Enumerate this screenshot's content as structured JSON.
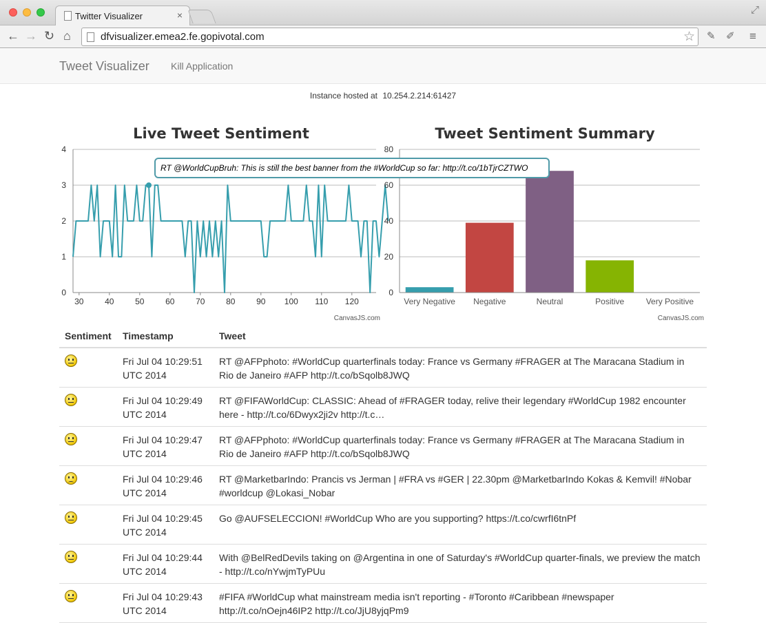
{
  "browser": {
    "tab_title": "Twitter Visualizer",
    "tab_close": "×",
    "url": "dfvisualizer.emea2.fe.gopivotal.com"
  },
  "navbar": {
    "brand": "Tweet Visualizer",
    "link": "Kill Application"
  },
  "instance": {
    "label": "Instance hosted at",
    "address": "10.254.2.214:61427"
  },
  "chart_data": [
    {
      "type": "line",
      "title": "Live Tweet Sentiment",
      "xlim": [
        28,
        128
      ],
      "ylim": [
        0,
        4
      ],
      "xticks": [
        30,
        40,
        50,
        60,
        70,
        80,
        90,
        100,
        110,
        120
      ],
      "yticks": [
        0,
        1,
        2,
        3,
        4
      ],
      "credit": "CanvasJS.com",
      "color": "#369ead",
      "highlight_x": 53,
      "tooltip": "RT @WorldCupBruh: This is still the best banner from the #WorldCup so far: http://t.co/1bTjrCZTWO",
      "x_start": 28,
      "values": [
        1,
        2,
        2,
        2,
        2,
        2,
        3,
        2,
        3,
        1,
        2,
        2,
        2,
        1,
        3,
        1,
        1,
        3,
        2,
        2,
        2,
        3,
        2,
        2,
        3,
        3,
        1,
        3,
        3,
        2,
        2,
        2,
        2,
        2,
        2,
        2,
        2,
        1,
        2,
        2,
        0,
        2,
        1,
        2,
        1,
        2,
        1,
        2,
        1,
        2,
        0,
        3,
        2,
        2,
        2,
        2,
        2,
        2,
        2,
        2,
        2,
        2,
        2,
        1,
        1,
        2,
        2,
        2,
        2,
        2,
        2,
        3,
        2,
        2,
        2,
        2,
        2,
        3,
        2,
        2,
        1,
        3,
        1,
        3,
        2,
        2,
        2,
        2,
        2,
        2,
        2,
        3,
        2,
        2,
        2,
        1,
        2,
        2,
        0,
        2,
        2,
        1,
        2,
        3,
        2
      ]
    },
    {
      "type": "bar",
      "title": "Tweet Sentiment Summary",
      "categories": [
        "Very Negative",
        "Negative",
        "Neutral",
        "Positive",
        "Very Positive"
      ],
      "values": [
        3,
        39,
        68,
        18,
        0
      ],
      "colors": [
        "#369ead",
        "#c24642",
        "#7f6084",
        "#86b402",
        "#a2d1cf"
      ],
      "ylim": [
        0,
        80
      ],
      "yticks": [
        0,
        20,
        40,
        60,
        80
      ],
      "credit": "CanvasJS.com"
    }
  ],
  "table": {
    "headers": [
      "Sentiment",
      "Timestamp",
      "Tweet"
    ],
    "rows": [
      {
        "mood": "neutral",
        "time": "Fri Jul 04 10:29:51 UTC 2014",
        "tweet": "RT @AFPphoto: #WorldCup quarterfinals today: France vs Germany #FRAGER at The Maracana Stadium in Rio de Janeiro #AFP http://t.co/bSqolb8JWQ"
      },
      {
        "mood": "happy",
        "time": "Fri Jul 04 10:29:49 UTC 2014",
        "tweet": "RT @FIFAWorldCup: CLASSIC: Ahead of #FRAGER today, relive their legendary #WorldCup 1982 encounter here - http://t.co/6Dwyx2ji2v http://t.c…"
      },
      {
        "mood": "neutral",
        "time": "Fri Jul 04 10:29:47 UTC 2014",
        "tweet": "RT @AFPphoto: #WorldCup quarterfinals today: France vs Germany #FRAGER at The Maracana Stadium in Rio de Janeiro #AFP http://t.co/bSqolb8JWQ"
      },
      {
        "mood": "sad",
        "time": "Fri Jul 04 10:29:46 UTC 2014",
        "tweet": "RT @MarketbarIndo: Prancis vs Jerman | #FRA vs #GER | 22.30pm @MarketbarIndo Kokas & Kemvil! #Nobar #worldcup @Lokasi_Nobar"
      },
      {
        "mood": "neutral",
        "time": "Fri Jul 04 10:29:45 UTC 2014",
        "tweet": "Go @AUFSELECCION! #WorldCup Who are you supporting? https://t.co/cwrfI6tnPf"
      },
      {
        "mood": "neutral",
        "time": "Fri Jul 04 10:29:44 UTC 2014",
        "tweet": "With @BelRedDevils taking on @Argentina in one of Saturday's #WorldCup quarter-finals, we preview the match - http://t.co/nYwjmTyPUu"
      },
      {
        "mood": "neutral",
        "time": "Fri Jul 04 10:29:43 UTC 2014",
        "tweet": "#FIFA #WorldCup what mainstream media isn't reporting - #Toronto #Caribbean #newspaper http://t.co/nOejn46IP2 http://t.co/JjU8yjqPm9"
      }
    ]
  }
}
